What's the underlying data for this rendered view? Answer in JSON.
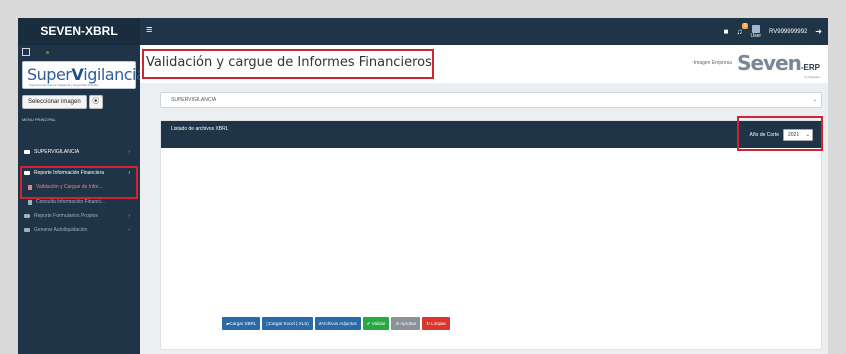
{
  "brand": {
    "part1": "SEVEN",
    "part2": "-XBRL"
  },
  "topbar": {
    "hamburger": "≡",
    "notif_count": "1",
    "user_caption": "User",
    "username": "RV999999992"
  },
  "sidebar": {
    "logo_text_a": "Super",
    "logo_text_v": "V",
    "logo_text_b": "igilancia",
    "logo_sub": "Superintendencia de Vigilancia y Seguridad Privada",
    "select_image_label": "Seleccionar imagen",
    "upload_glyph": "⦿",
    "menu_header": "MENU PRINCIPAL",
    "items": [
      {
        "label": "SUPERVIGILANCIA",
        "caret": "›"
      },
      {
        "label": "Reporte Información Financiera",
        "caret": "›"
      },
      {
        "label": "Validación y Cargue de Infor..."
      },
      {
        "label": "Consulta Información Financi..."
      },
      {
        "label": "Reporte Formularios Propios",
        "caret": "›"
      },
      {
        "label": "Generar Autoliquidación",
        "caret": "›"
      }
    ]
  },
  "header": {
    "page_title": "Validación y cargue de Informes Financieros",
    "empresa_img_alt": "Imagen Empresa",
    "seven_logo": "Seven",
    "seven_erp": "-ERP",
    "seven_by": "by Digiware"
  },
  "company_select": {
    "value": "SUPERVIGILANCIA"
  },
  "panel": {
    "title": "Listado de archivos XBRL",
    "year_label": "Año de Corte",
    "year_value": "2021"
  },
  "buttons": {
    "cargar_xbrl": "Cargar XBRL",
    "cargar_excel": "Cargar Excel (.XLS)",
    "archivos_adjuntos": "Archivos Adjuntos",
    "validar": "✔ Validar",
    "aprobar": "⊘ Aprobar",
    "limpiar": "↻ Limpiar"
  },
  "colors": {
    "navy": "#1f3447",
    "highlight": "#d02530",
    "blue": "#2b6aa8",
    "green": "#27a844",
    "red": "#d8372c"
  }
}
